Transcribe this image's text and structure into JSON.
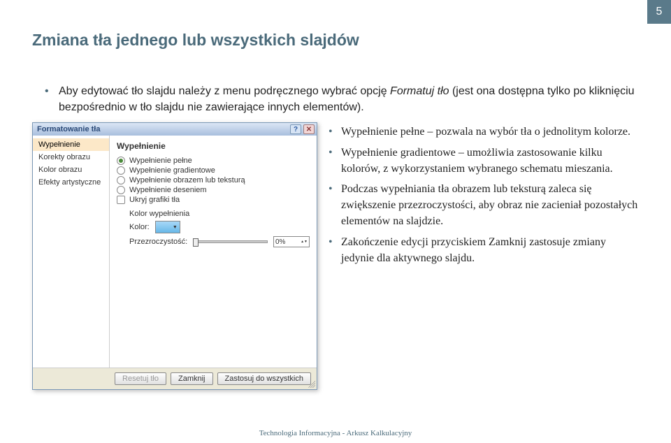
{
  "page_number": "5",
  "title": "Zmiana tła jednego lub wszystkich slajdów",
  "intro": {
    "prefix": "Aby edytować tło slajdu należy z menu podręcznego wybrać opcję ",
    "italic": "Formatuj tło",
    "suffix": " (jest ona dostępna tylko po kliknięciu bezpośrednio w tło slajdu nie zawierające innych elementów)."
  },
  "dialog": {
    "title": "Formatowanie tła",
    "help_icon": "?",
    "close_icon": "✕",
    "side": [
      "Wypełnienie",
      "Korekty obrazu",
      "Kolor obrazu",
      "Efekty artystyczne"
    ],
    "heading": "Wypełnienie",
    "options": [
      {
        "label": "Wypełnienie pełne",
        "selected": true
      },
      {
        "label": "Wypełnienie gradientowe",
        "selected": false
      },
      {
        "label": "Wypełnienie obrazem lub teksturą",
        "selected": false
      },
      {
        "label": "Wypełnienie deseniem",
        "selected": false
      }
    ],
    "checkbox": "Ukryj grafiki tła",
    "color_group_label": "Kolor wypełnienia",
    "color_label": "Kolor:",
    "transparency_label": "Przezroczystość:",
    "transparency_value": "0%",
    "buttons": {
      "reset": "Resetuj tło",
      "close": "Zamknij",
      "apply_all": "Zastosuj do wszystkich"
    }
  },
  "bullets": [
    "Wypełnienie pełne – pozwala na wybór tła o jednolitym kolorze.",
    "Wypełnienie gradientowe – umożliwia zastosowanie kilku kolorów, z wykorzystaniem wybranego schematu mieszania.",
    "Podczas wypełniania tła obrazem lub teksturą zaleca się zwiększenie przezroczystości, aby obraz nie zacieniał pozostałych elementów na slajdzie.",
    "Zakończenie edycji przyciskiem Zamknij zastosuje zmiany jedynie dla aktywnego slajdu."
  ],
  "footer": "Technologia Informacyjna - Arkusz Kalkulacyjny"
}
